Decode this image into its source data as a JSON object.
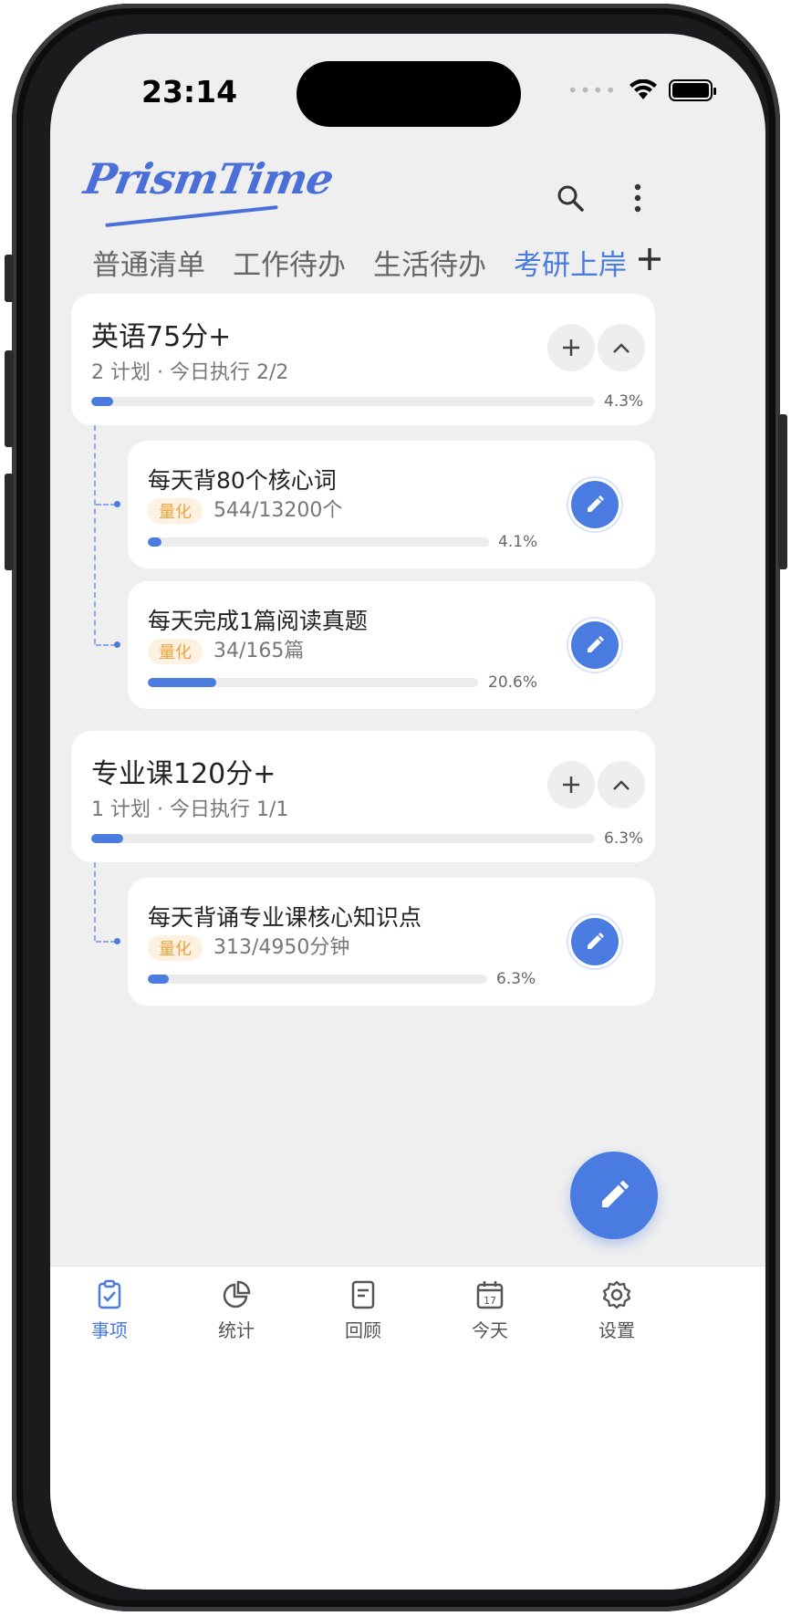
{
  "status_bar": {
    "time": "23:14"
  },
  "app": {
    "logo_text": "PrismTime"
  },
  "header": {
    "search_icon": "search-icon",
    "more_icon": "more-vertical-icon"
  },
  "tabs": [
    {
      "label": "普通清单",
      "active": false
    },
    {
      "label": "工作待办",
      "active": false
    },
    {
      "label": "生活待办",
      "active": false
    },
    {
      "label": "考研上岸",
      "active": true
    }
  ],
  "tab_add_label": "+",
  "goals": [
    {
      "title": "英语75分+",
      "subtitle": "2 计划 · 今日执行 2/2",
      "progress_pct": "4.3%",
      "progress": 0.043,
      "plans": [
        {
          "title": "每天背80个核心词",
          "badge": "量化",
          "count": "544/13200个",
          "progress_pct": "4.1%",
          "progress": 0.041
        },
        {
          "title": "每天完成1篇阅读真题",
          "badge": "量化",
          "count": "34/165篇",
          "progress_pct": "20.6%",
          "progress": 0.206
        }
      ]
    },
    {
      "title": "专业课120分+",
      "subtitle": "1 计划 · 今日执行 1/1",
      "progress_pct": "6.3%",
      "progress": 0.063,
      "plans": [
        {
          "title": "每天背诵专业课核心知识点",
          "badge": "量化",
          "count": "313/4950分钟",
          "progress_pct": "6.3%",
          "progress": 0.063
        }
      ]
    }
  ],
  "bottom_nav": [
    {
      "label": "事项",
      "icon": "clipboard-check-icon",
      "active": true
    },
    {
      "label": "统计",
      "icon": "pie-chart-icon",
      "active": false
    },
    {
      "label": "回顾",
      "icon": "document-icon",
      "active": false
    },
    {
      "label": "今天",
      "icon": "calendar-icon",
      "active": false,
      "day": "17"
    },
    {
      "label": "设置",
      "icon": "gear-icon",
      "active": false
    }
  ],
  "colors": {
    "accent": "#4a7be0",
    "badge_text": "#f0a23a",
    "badge_bg": "#fdf1e1",
    "background": "#efefef"
  }
}
